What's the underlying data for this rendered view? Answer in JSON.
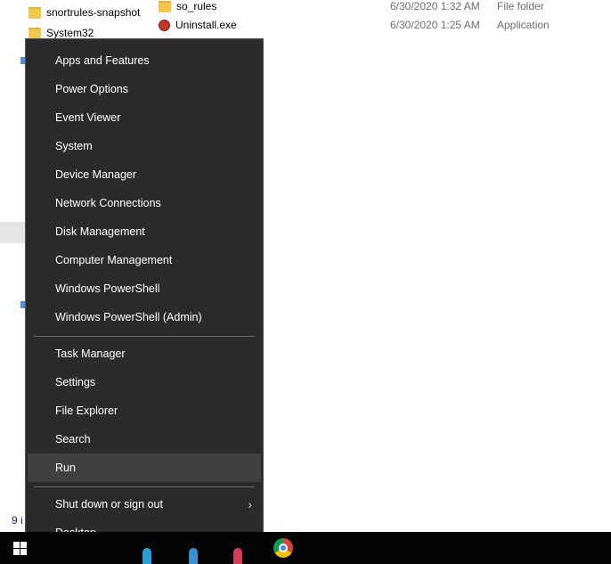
{
  "explorer": {
    "nav_items": [
      {
        "label": "snortrules-snapshot"
      },
      {
        "label": "System32"
      }
    ],
    "files": [
      {
        "name": "so_rules",
        "date": "6/30/2020 1:32 AM",
        "type": "File folder",
        "icon": "folder-icon"
      },
      {
        "name": "Uninstall.exe",
        "date": "6/30/2020 1:25 AM",
        "type": "Application",
        "icon": "application-icon"
      }
    ],
    "status_text": "9 i"
  },
  "menu": {
    "group1": [
      {
        "label": "Apps and Features"
      },
      {
        "label": "Power Options"
      },
      {
        "label": "Event Viewer"
      },
      {
        "label": "System"
      },
      {
        "label": "Device Manager"
      },
      {
        "label": "Network Connections"
      },
      {
        "label": "Disk Management"
      },
      {
        "label": "Computer Management"
      },
      {
        "label": "Windows PowerShell"
      },
      {
        "label": "Windows PowerShell (Admin)"
      }
    ],
    "group2": [
      {
        "label": "Task Manager"
      },
      {
        "label": "Settings"
      },
      {
        "label": "File Explorer"
      },
      {
        "label": "Search"
      },
      {
        "label": "Run"
      }
    ],
    "group3": [
      {
        "label": "Shut down or sign out",
        "submenu_icon": "chevron-right-icon"
      },
      {
        "label": "Desktop"
      }
    ],
    "highlighted": "Run"
  },
  "taskbar": {
    "start_icon": "windows-logo-icon",
    "pinned": [
      "chrome-icon"
    ],
    "colors": {
      "background": "#050505",
      "menu_background": "#2b2b2b",
      "menu_highlight": "#414141"
    }
  }
}
